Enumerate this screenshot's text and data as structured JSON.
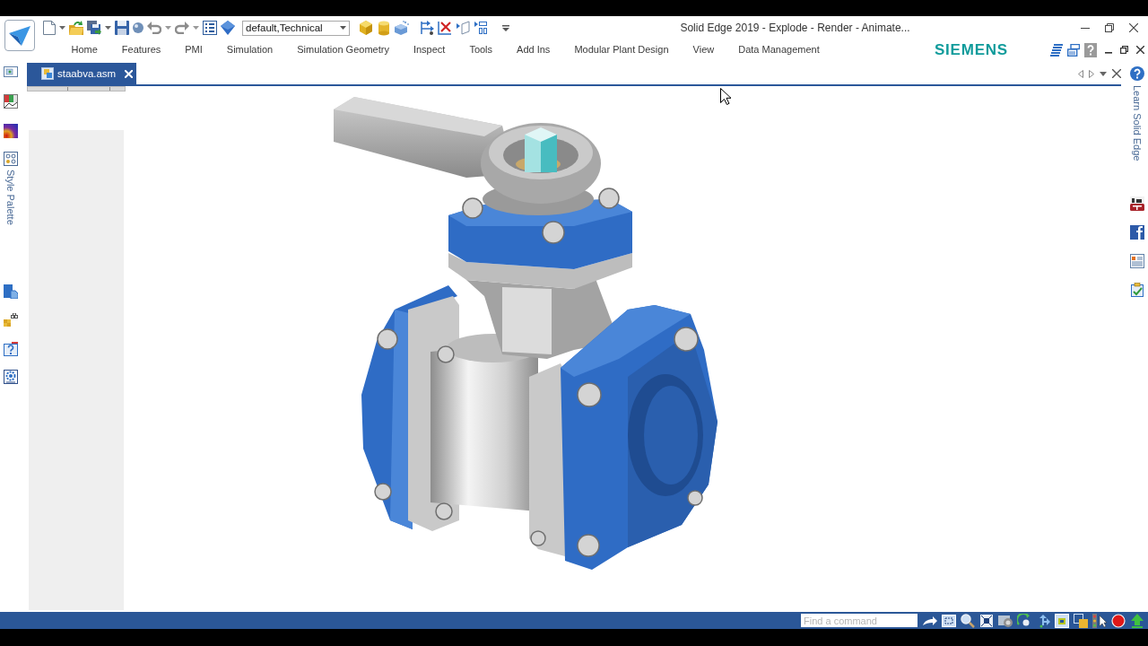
{
  "title_bar": {
    "title": "Solid Edge 2019 - Explode - Render - Animate...",
    "style_combo": {
      "value": "default,Technical"
    }
  },
  "ribbon_tabs": [
    {
      "label": "Home",
      "selected": false
    },
    {
      "label": "Features",
      "selected": false
    },
    {
      "label": "PMI",
      "selected": false
    },
    {
      "label": "Simulation",
      "selected": false
    },
    {
      "label": "Simulation Geometry",
      "selected": false
    },
    {
      "label": "Inspect",
      "selected": false
    },
    {
      "label": "Tools",
      "selected": false
    },
    {
      "label": "Add Ins",
      "selected": false
    },
    {
      "label": "Modular Plant Design",
      "selected": false
    },
    {
      "label": "View",
      "selected": false
    },
    {
      "label": "Data Management",
      "selected": false
    }
  ],
  "brand": "SIEMENS",
  "document_tabs": [
    {
      "label": "staabva.asm",
      "selected": true
    }
  ],
  "left_dock": {
    "tab_label": "Style Palette"
  },
  "right_dock": {
    "tab_label": "Learn Solid Edge"
  },
  "status_bar": {
    "command_search": {
      "placeholder": "Find a command"
    }
  }
}
